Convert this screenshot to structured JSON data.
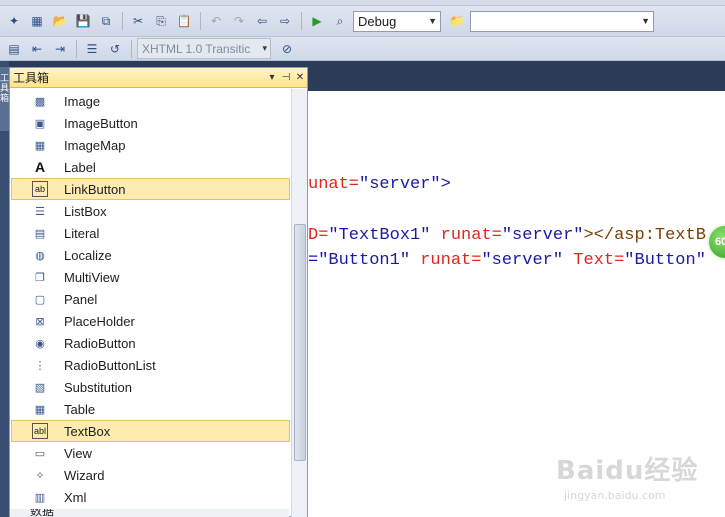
{
  "toolbar": {
    "config_combo": "Debug",
    "search_combo": "",
    "doctype_combo": "XHTML 1.0 Transitic"
  },
  "toolbox": {
    "title": "工具箱",
    "items": [
      {
        "label": "Image",
        "icon": "image-icon",
        "glyph": "▩"
      },
      {
        "label": "ImageButton",
        "icon": "imagebutton-icon",
        "glyph": "▣"
      },
      {
        "label": "ImageMap",
        "icon": "imagemap-icon",
        "glyph": "▦"
      },
      {
        "label": "Label",
        "icon": "label-icon",
        "glyph": "A"
      },
      {
        "label": "LinkButton",
        "icon": "linkbutton-icon",
        "glyph": "ab"
      },
      {
        "label": "ListBox",
        "icon": "listbox-icon",
        "glyph": "☰"
      },
      {
        "label": "Literal",
        "icon": "literal-icon",
        "glyph": "▤"
      },
      {
        "label": "Localize",
        "icon": "localize-icon",
        "glyph": "◍"
      },
      {
        "label": "MultiView",
        "icon": "multiview-icon",
        "glyph": "❐"
      },
      {
        "label": "Panel",
        "icon": "panel-icon",
        "glyph": "▢"
      },
      {
        "label": "PlaceHolder",
        "icon": "placeholder-icon",
        "glyph": "⊠"
      },
      {
        "label": "RadioButton",
        "icon": "radiobutton-icon",
        "glyph": "◉"
      },
      {
        "label": "RadioButtonList",
        "icon": "radiobuttonlist-icon",
        "glyph": "⋮"
      },
      {
        "label": "Substitution",
        "icon": "substitution-icon",
        "glyph": "▧"
      },
      {
        "label": "Table",
        "icon": "table-icon",
        "glyph": "▦"
      },
      {
        "label": "TextBox",
        "icon": "textbox-icon",
        "glyph": "abl"
      },
      {
        "label": "View",
        "icon": "view-icon",
        "glyph": "▭"
      },
      {
        "label": "Wizard",
        "icon": "wizard-icon",
        "glyph": "✧"
      },
      {
        "label": "Xml",
        "icon": "xml-icon",
        "glyph": "▥"
      }
    ],
    "selected": [
      "LinkButton",
      "TextBox"
    ],
    "next_group": "数据"
  },
  "editor": {
    "line1": {
      "attr": "unat=",
      "val": "\"server\"",
      "tag": ">"
    },
    "line2": {
      "attr1": "D=",
      "val1": "\"TextBox1\"",
      "attr2": " runat=",
      "val2": "\"server\"",
      "tag": "></asp:TextB"
    },
    "line3": {
      "val0": "=\"Button1\"",
      "attr1": " runat=",
      "val1": "\"server\"",
      "attr2": " Text=",
      "val2": "\"Button\""
    }
  },
  "bubble": "60",
  "watermark": {
    "brand": "Baidu经验",
    "url": "jingyan.baidu.com"
  }
}
